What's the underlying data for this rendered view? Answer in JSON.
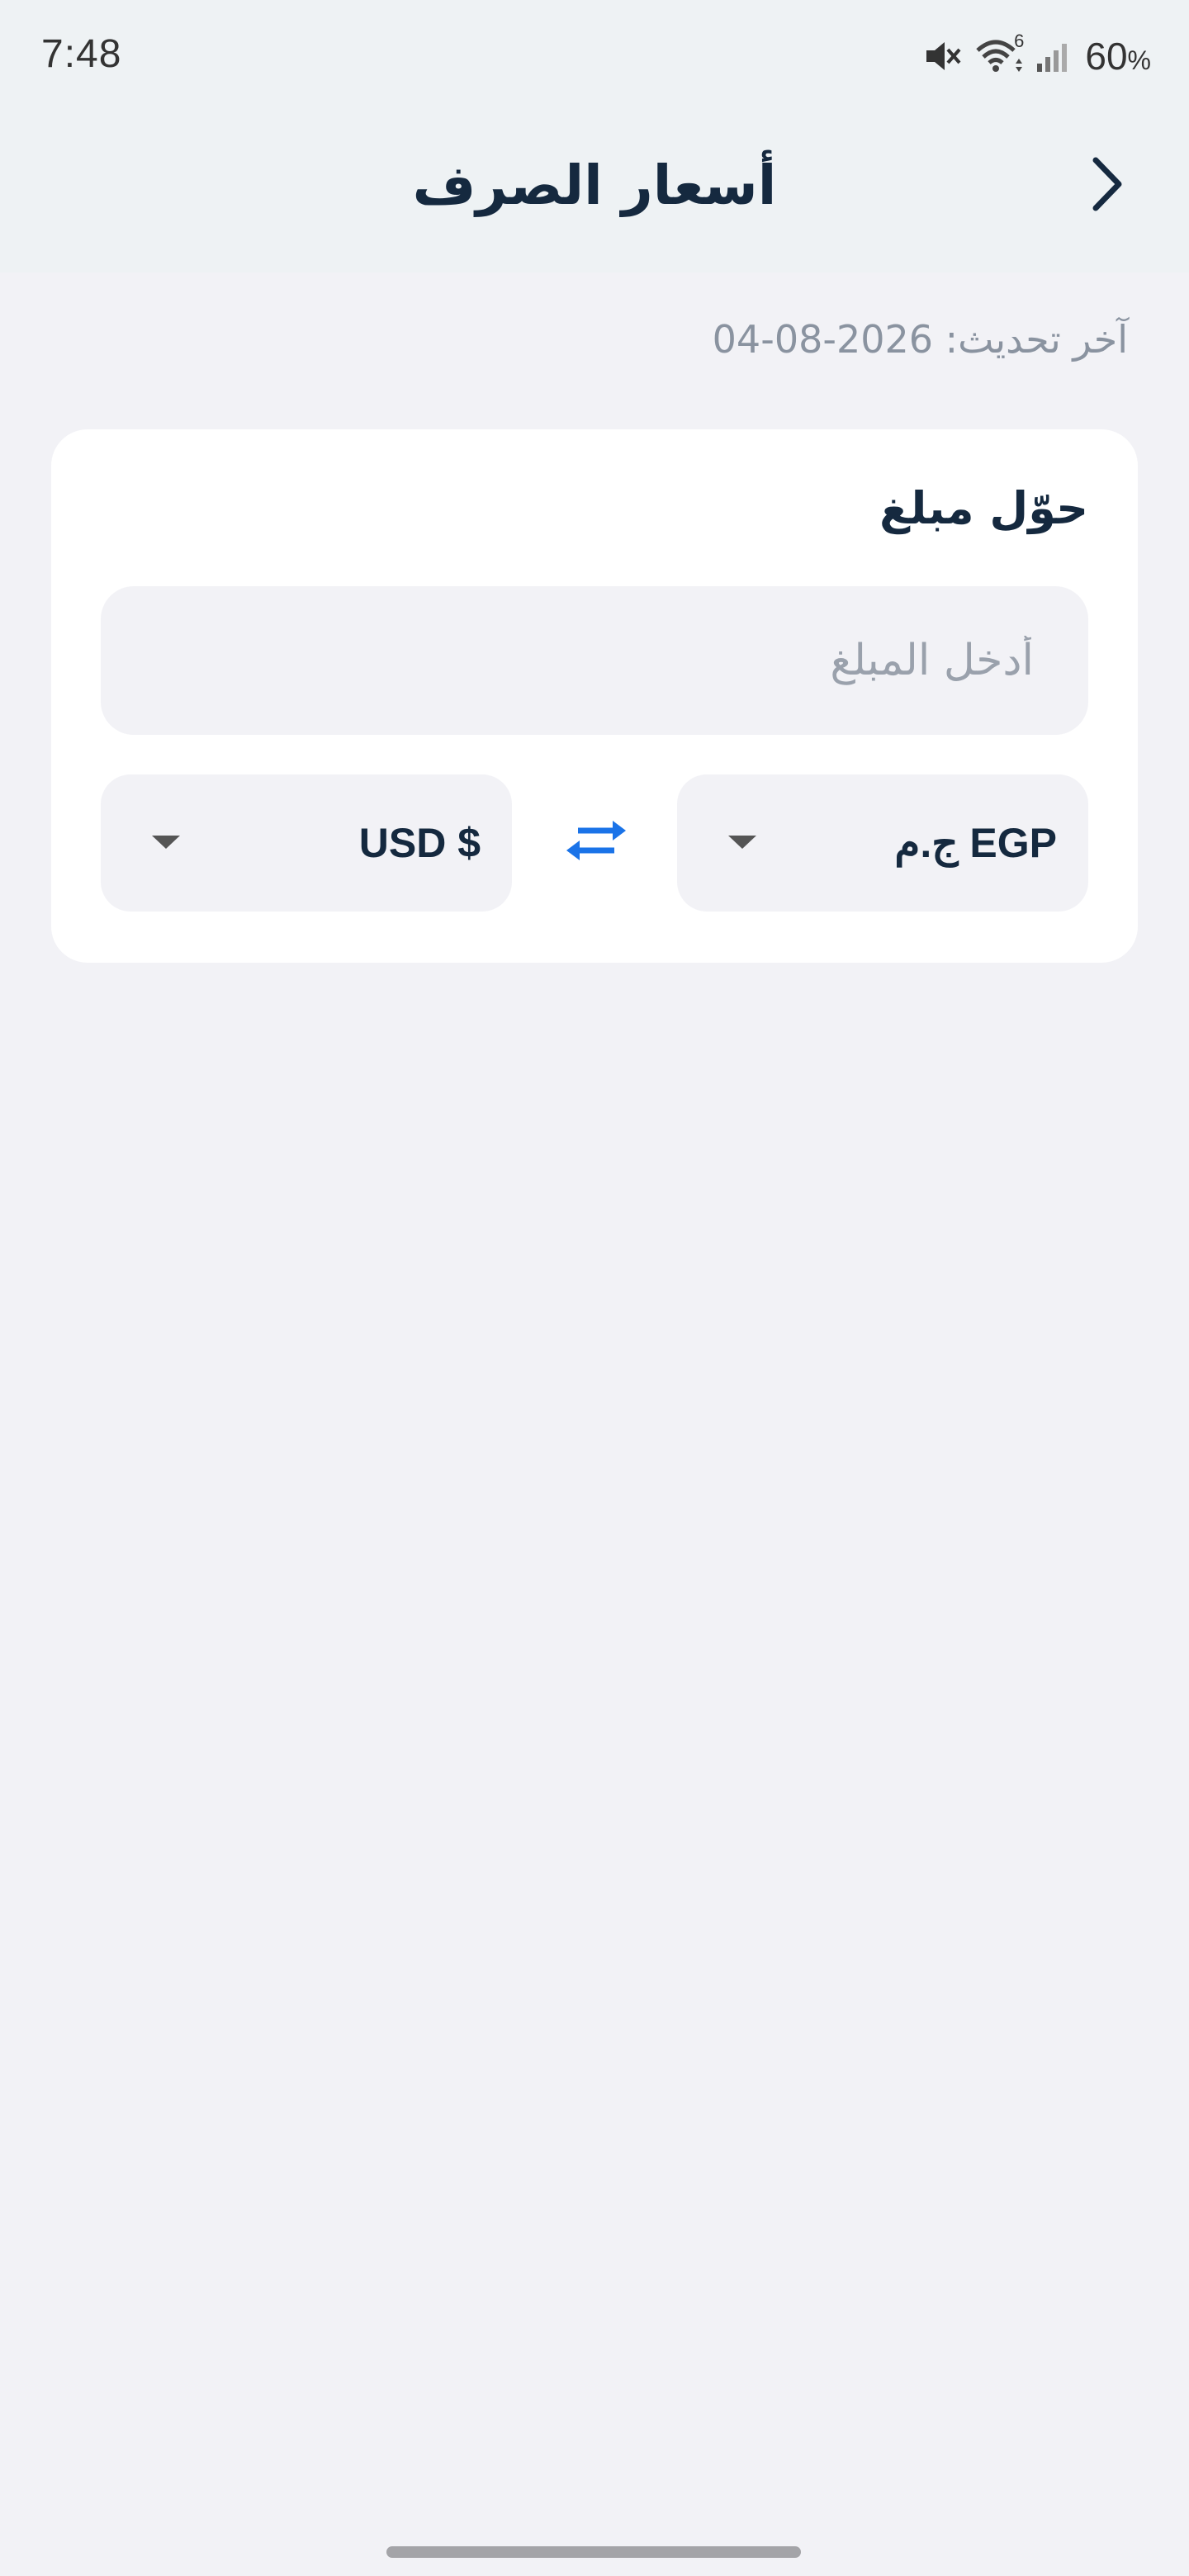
{
  "status_bar": {
    "time": "7:48",
    "battery": "60",
    "battery_unit": "%",
    "wifi_badge": "6",
    "icons": [
      "mute-icon",
      "wifi-icon",
      "signal-icon"
    ]
  },
  "header": {
    "title": "أسعار الصرف",
    "back_icon": "chevron-right-icon"
  },
  "last_update": "آخر تحديث: 2026-08-04",
  "converter": {
    "title": "حوّل مبلغ",
    "amount_placeholder": "أدخل المبلغ",
    "amount_value": "",
    "from_currency": "ج.م EGP",
    "to_currency": "USD $",
    "swap_icon": "swap-arrows-icon",
    "dropdown_icon": "caret-down-icon"
  },
  "colors": {
    "accent": "#1a73e8",
    "title_text": "#15293f",
    "muted_text": "#8a93a0",
    "background": "#f2f2f6",
    "header_background": "#eef2f4",
    "card_background": "#ffffff"
  }
}
